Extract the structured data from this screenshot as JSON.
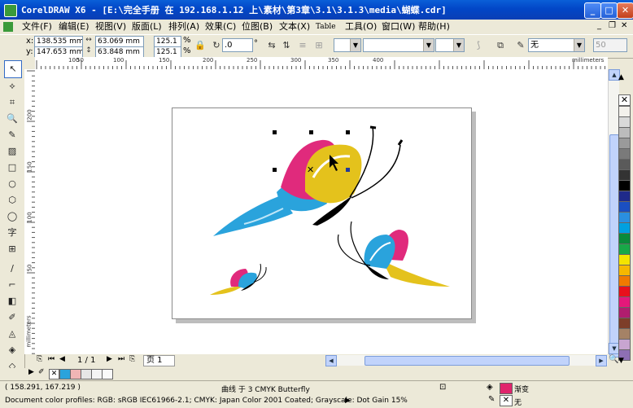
{
  "window": {
    "title": "CorelDRAW X6 - [E:\\完全手册 在 192.168.1.12 上\\素材\\第3章\\3.1\\3.1.3\\media\\蝴蝶.cdr]"
  },
  "menu": [
    "文件(F)",
    "编辑(E)",
    "视图(V)",
    "版面(L)",
    "排列(A)",
    "效果(C)",
    "位图(B)",
    "文本(X)",
    "Table",
    "工具(O)",
    "窗口(W)",
    "帮助(H)"
  ],
  "property_bar": {
    "x_label": "x:",
    "x_value": "138.535 mm",
    "y_label": "y:",
    "y_value": "147.653 mm",
    "width_value": "63.069 mm",
    "height_value": "63.848 mm",
    "scale_x": "125.1",
    "scale_y": "125.1",
    "percent": "%",
    "rotation": ".0",
    "degree": "°",
    "outline_width": "无",
    "text_box": "50"
  },
  "rulers": {
    "units": "millimeters",
    "h_ticks": [
      "100",
      "50",
      "100",
      "150",
      "200",
      "250",
      "300",
      "350",
      "400"
    ],
    "v_ticks": [
      "200",
      "150",
      "100",
      "50"
    ],
    "v_units": "millimeters"
  },
  "page_nav": {
    "page_count": "1 / 1",
    "page_tab": "页 1"
  },
  "status": {
    "coords": "( 158.291, 167.219 )",
    "selection": "曲线 于 3 CMYK Butterfly",
    "fill_label": "渐变",
    "outline_label": "无",
    "profiles": "Document color profiles: RGB: sRGB IEC61966-2.1; CMYK: Japan Color 2001 Coated; Grayscale: Dot Gain 15%"
  },
  "palette": [
    "#f3f1ec",
    "#d9d9d9",
    "#bcbcbc",
    "#9a9a9a",
    "#7a7a7a",
    "#5a5a5a",
    "#333333",
    "#000000",
    "#1f2a8a",
    "#1b4fc1",
    "#2a8fe0",
    "#00a0e0",
    "#0a8a3a",
    "#18a848",
    "#f4e400",
    "#f6b800",
    "#f07a00",
    "#e8101c",
    "#e4187a",
    "#b01e6e",
    "#7d3e2a",
    "#a58266",
    "#c8a5d0",
    "#8e6fb4"
  ],
  "colors": {
    "magenta": "#e02a7c",
    "cyan": "#2aa3dc",
    "yellow": "#e4c21c",
    "fill_swatch": "#e0246c"
  }
}
